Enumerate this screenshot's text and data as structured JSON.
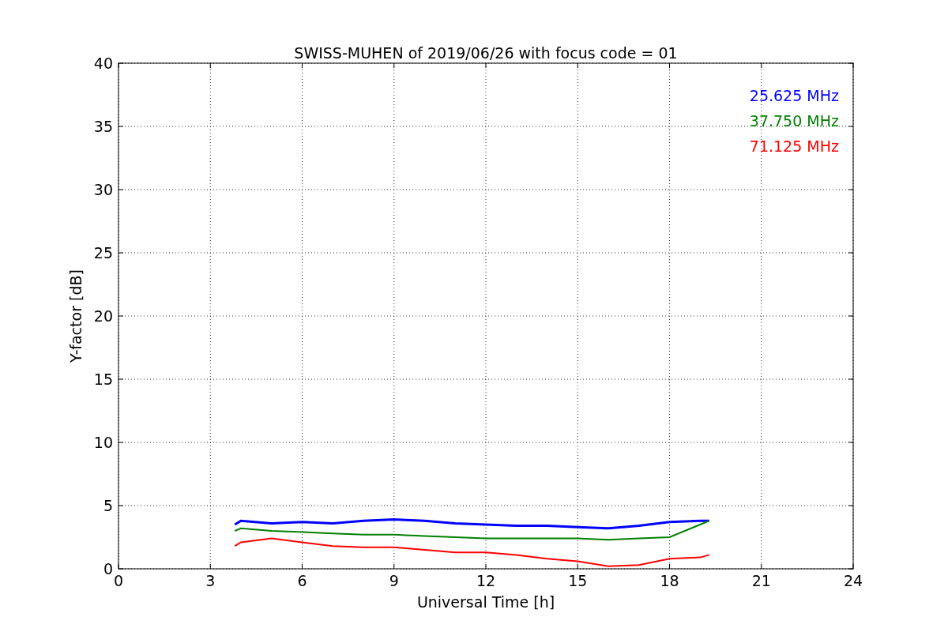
{
  "chart_data": {
    "type": "line",
    "title": "SWISS-MUHEN of 2019/06/26 with focus code = 01",
    "xlabel": "Universal Time [h]",
    "ylabel": "Y-factor [dB]",
    "xlim": [
      0,
      24
    ],
    "ylim": [
      0,
      40
    ],
    "xticks": [
      0,
      3,
      6,
      9,
      12,
      15,
      18,
      21,
      24
    ],
    "yticks": [
      0,
      5,
      10,
      15,
      20,
      25,
      30,
      35,
      40
    ],
    "grid": true,
    "x": [
      3.8,
      4,
      5,
      6,
      7,
      8,
      9,
      10,
      11,
      12,
      13,
      14,
      15,
      16,
      17,
      18,
      19,
      19.3
    ],
    "series": [
      {
        "name": "25.625 MHz",
        "color": "#0000ff",
        "values": [
          3.5,
          3.8,
          3.6,
          3.7,
          3.6,
          3.8,
          3.9,
          3.8,
          3.6,
          3.5,
          3.4,
          3.4,
          3.3,
          3.2,
          3.4,
          3.7,
          3.8,
          3.8
        ]
      },
      {
        "name": "37.750 MHz",
        "color": "#008000",
        "values": [
          3.0,
          3.2,
          3.0,
          2.9,
          2.8,
          2.7,
          2.7,
          2.6,
          2.5,
          2.4,
          2.4,
          2.4,
          2.4,
          2.3,
          2.4,
          2.5,
          3.5,
          3.8
        ]
      },
      {
        "name": "71.125 MHz",
        "color": "#ff0000",
        "values": [
          1.8,
          2.1,
          2.4,
          2.1,
          1.8,
          1.7,
          1.7,
          1.5,
          1.3,
          1.3,
          1.1,
          0.8,
          0.6,
          0.2,
          0.3,
          0.8,
          0.9,
          1.1
        ]
      }
    ]
  }
}
